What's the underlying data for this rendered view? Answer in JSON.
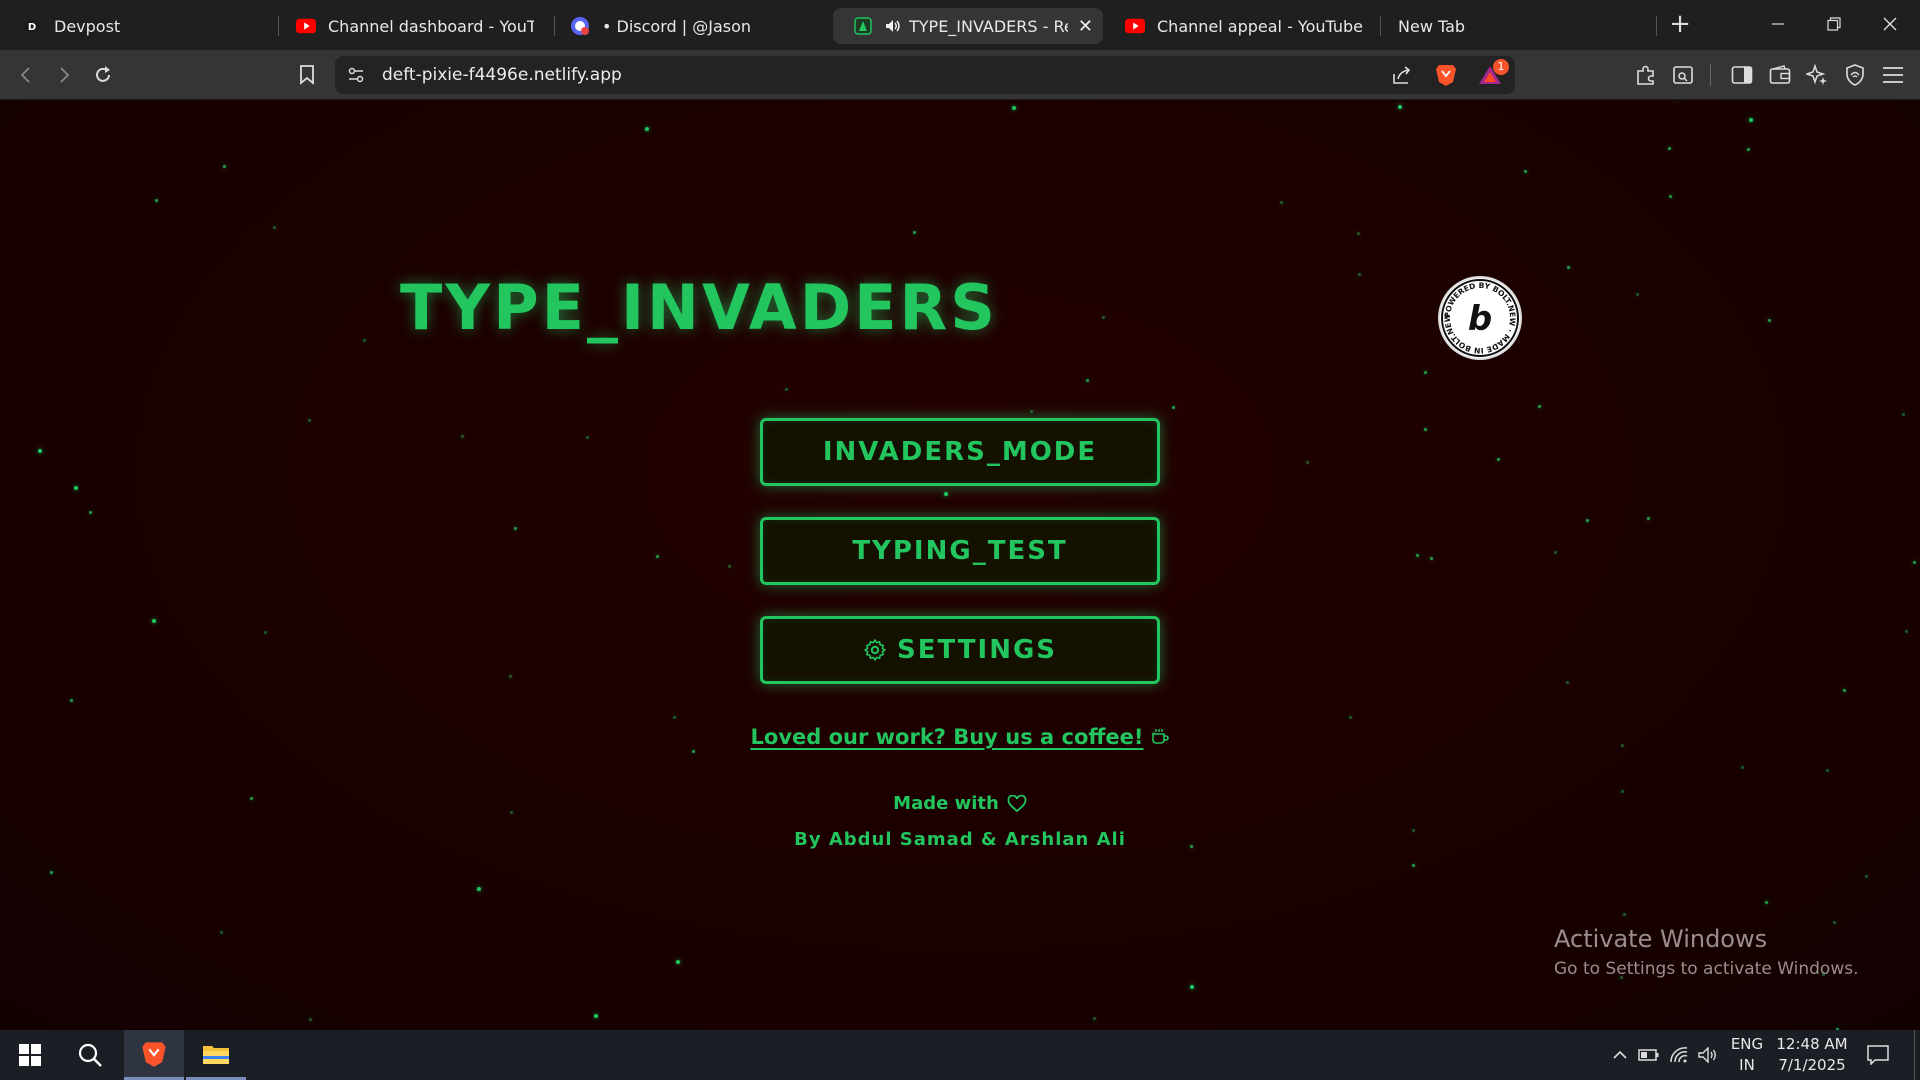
{
  "browser": {
    "tabs": [
      {
        "title": "Devpost",
        "favicon": "devpost-icon",
        "active": false
      },
      {
        "title": "Channel dashboard - YouTube Studio",
        "favicon": "youtube-icon",
        "active": false
      },
      {
        "title": "• Discord | @Jason",
        "favicon": "discord-icon",
        "active": false
      },
      {
        "title": "TYPE_INVADERS - Retro",
        "favicon": "bolt-icon",
        "active": true,
        "audio": "speaker-icon"
      },
      {
        "title": "Channel appeal - YouTube",
        "favicon": "youtube-icon",
        "active": false
      },
      {
        "title": "New Tab",
        "favicon": "",
        "active": false
      }
    ],
    "new_tab_glyph": "+",
    "close_glyph": "✕",
    "url": "deft-pixie-f4496e.netlify.app",
    "notification_count": "1",
    "accent": "#fb542b"
  },
  "page": {
    "title": "TYPE_INVADERS",
    "badge_text": "POWERED BY BOLT.NEW · MADE IN BOLT.NEW ·",
    "badge_letter": "b",
    "menu": [
      {
        "label": "INVADERS_MODE"
      },
      {
        "label": "TYPING_TEST"
      },
      {
        "label": "SETTINGS",
        "icon": "gear-icon"
      }
    ],
    "coffee_link": "Loved our work? Buy us a coffee!",
    "made_with": "Made with",
    "authors": "By Abdul Samad & Arshlan Ali",
    "accent": "#22c55e",
    "background": "#1a0000"
  },
  "watermark": {
    "line1": "Activate Windows",
    "line2": "Go to Settings to activate Windows."
  },
  "taskbar": {
    "language": "ENG",
    "region": "IN",
    "time": "12:48 AM",
    "date": "7/1/2025"
  }
}
